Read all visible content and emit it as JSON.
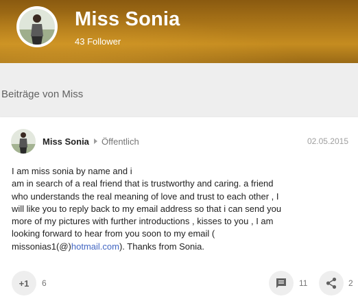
{
  "header": {
    "name": "Miss Sonia",
    "followers": "43 Follower",
    "avatar_icon": "profile-photo"
  },
  "section": {
    "title": "Beiträge von Miss"
  },
  "post": {
    "author": "Miss Sonia",
    "visibility": "Öffentlich",
    "date": "02.05.2015",
    "lines": [
      "I am miss sonia by name and i",
      "am in search of a real friend that is trustworthy and caring. a friend",
      "who understands the real meaning of love and trust to each other , I",
      "will like you to reply back to my email address so that i can send you",
      "more of my pictures with further introductions , kisses to you , I am",
      "looking forward to hear from you soon to my email ("
    ],
    "last_line_prefix": "missonias1(@)",
    "last_line_link": "hotmail.com",
    "last_line_suffix": "). Thanks from Sonia.",
    "actions": {
      "plusone_label": "+1",
      "plusone_count": "6",
      "comment_count": "11",
      "share_count": "2"
    }
  },
  "colors": {
    "banner": "#b07a1a",
    "link": "#4266c2"
  }
}
